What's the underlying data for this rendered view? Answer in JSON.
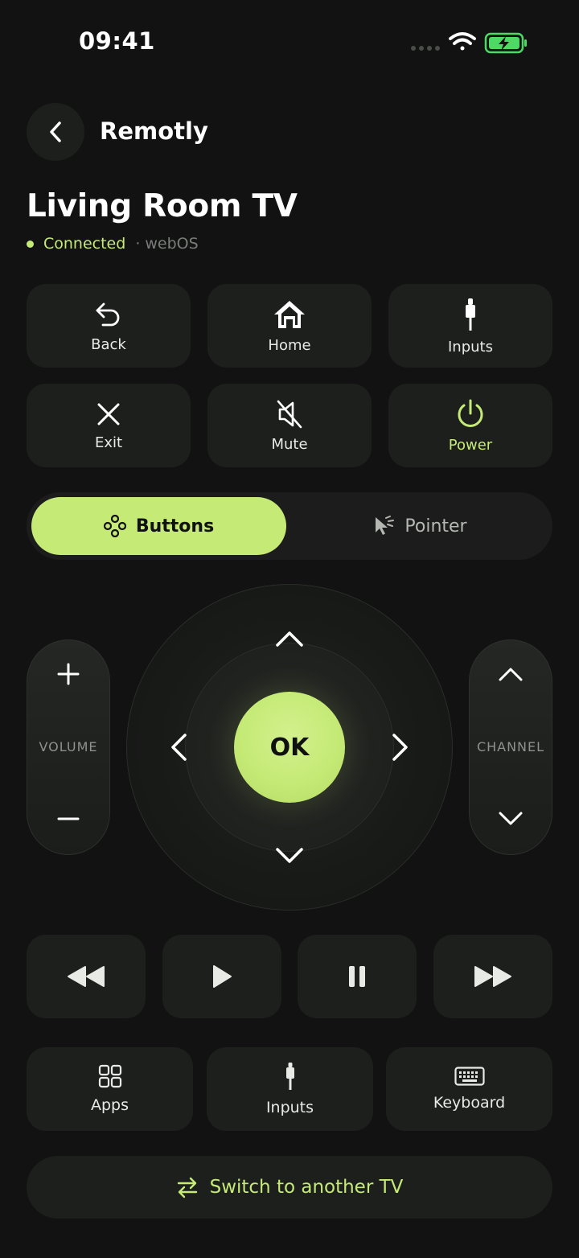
{
  "status": {
    "time": "09:41"
  },
  "header": {
    "app_name": "Remotly",
    "tv_name": "Living Room TV",
    "status": "Connected",
    "os": "· webOS"
  },
  "quick": [
    {
      "label": "Back"
    },
    {
      "label": "Home"
    },
    {
      "label": "Inputs"
    },
    {
      "label": "Exit"
    },
    {
      "label": "Mute"
    },
    {
      "label": "Power"
    }
  ],
  "mode": {
    "active": "Buttons",
    "inactive": "Pointer"
  },
  "dpad": {
    "ok": "OK"
  },
  "volume": {
    "label": "VOLUME"
  },
  "channel": {
    "label": "CHANNEL"
  },
  "bottom": [
    {
      "label": "Apps"
    },
    {
      "label": "Inputs"
    },
    {
      "label": "Keyboard"
    }
  ],
  "switch": {
    "label": "Switch to another TV"
  },
  "colors": {
    "accent": "#c5ea76",
    "background": "#111211",
    "tile": "#1d1f1d",
    "battery": "#4cd964"
  },
  "icons": {
    "back": "undo-arrow-icon",
    "home": "house-icon",
    "inputs": "plug-icon",
    "exit": "x-icon",
    "mute": "speaker-mute-icon",
    "power": "power-icon",
    "buttons": "gamepad-icon",
    "pointer": "cursor-icon"
  }
}
